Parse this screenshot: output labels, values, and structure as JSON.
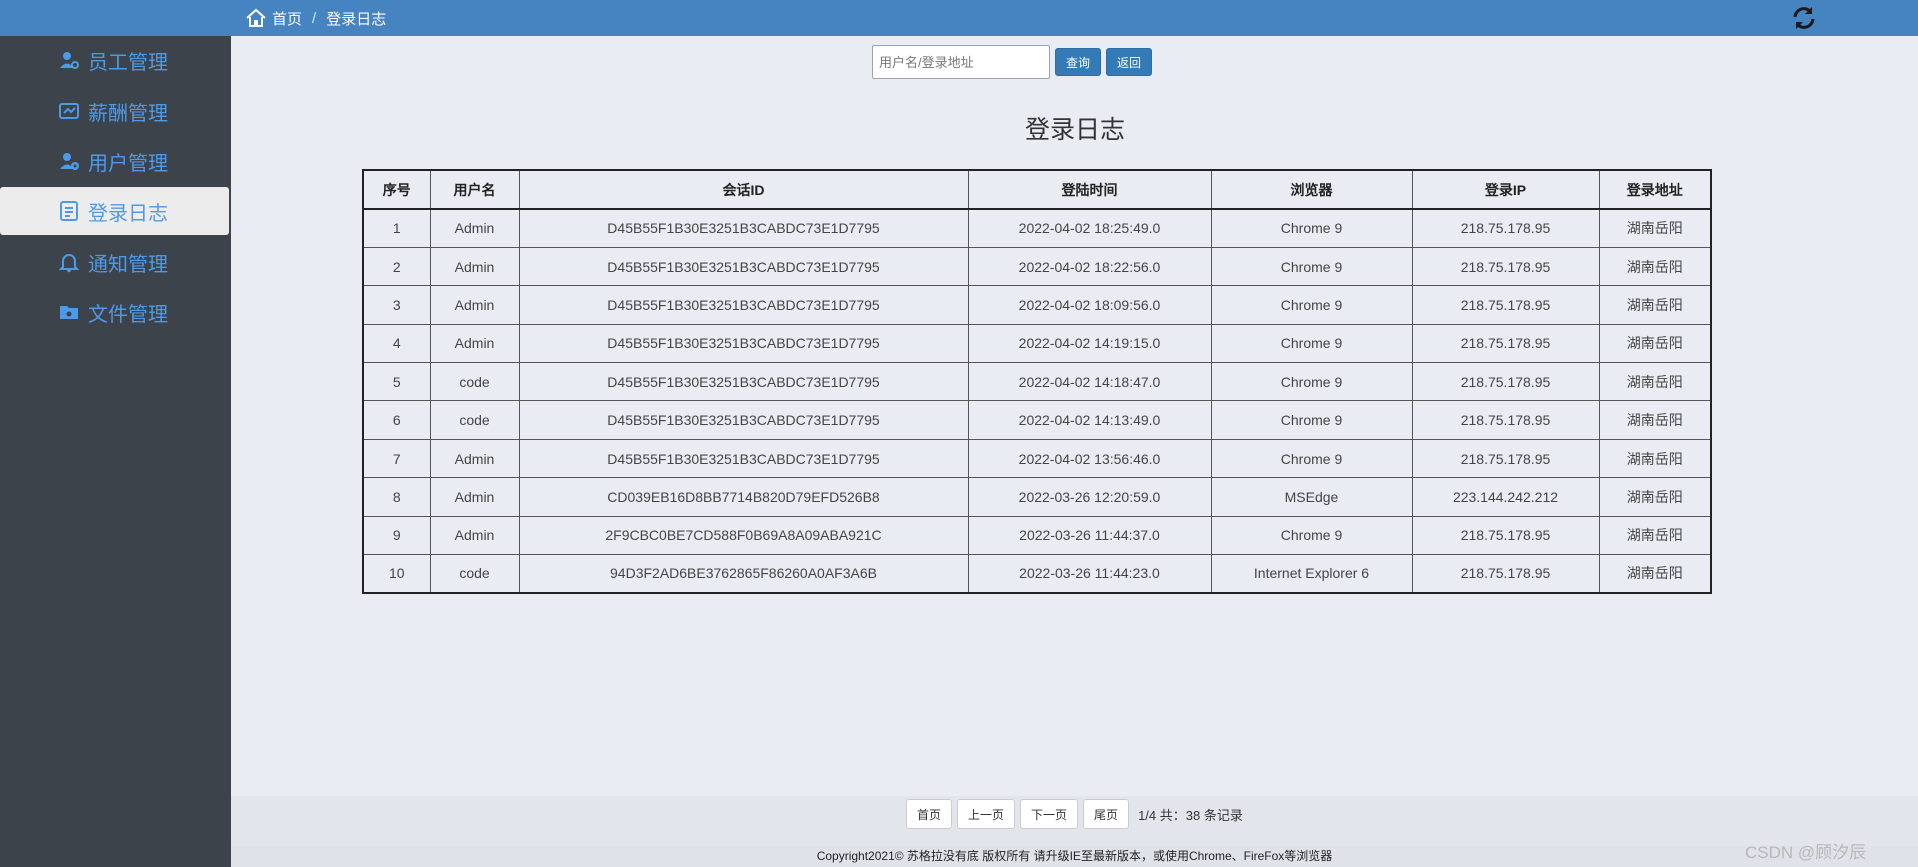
{
  "breadcrumb": {
    "home": "首页",
    "separator": "/",
    "current": "登录日志"
  },
  "sidebar": {
    "items": [
      {
        "label": "员工管理",
        "icon": "employee-icon",
        "active": false
      },
      {
        "label": "薪酬管理",
        "icon": "salary-icon",
        "active": false
      },
      {
        "label": "用户管理",
        "icon": "user-manage-icon",
        "active": false
      },
      {
        "label": "登录日志",
        "icon": "log-icon",
        "active": true
      },
      {
        "label": "通知管理",
        "icon": "bell-icon",
        "active": false
      },
      {
        "label": "文件管理",
        "icon": "folder-icon",
        "active": false
      }
    ]
  },
  "search": {
    "placeholder": "用户名/登录地址",
    "query_label": "查询",
    "back_label": "返回"
  },
  "title": "登录日志",
  "table": {
    "headers": [
      "序号",
      "用户名",
      "会话ID",
      "登陆时间",
      "浏览器",
      "登录IP",
      "登录地址"
    ],
    "rows": [
      [
        "1",
        "Admin",
        "D45B55F1B30E3251B3CABDC73E1D7795",
        "2022-04-02 18:25:49.0",
        "Chrome 9",
        "218.75.178.95",
        "湖南岳阳"
      ],
      [
        "2",
        "Admin",
        "D45B55F1B30E3251B3CABDC73E1D7795",
        "2022-04-02 18:22:56.0",
        "Chrome 9",
        "218.75.178.95",
        "湖南岳阳"
      ],
      [
        "3",
        "Admin",
        "D45B55F1B30E3251B3CABDC73E1D7795",
        "2022-04-02 18:09:56.0",
        "Chrome 9",
        "218.75.178.95",
        "湖南岳阳"
      ],
      [
        "4",
        "Admin",
        "D45B55F1B30E3251B3CABDC73E1D7795",
        "2022-04-02 14:19:15.0",
        "Chrome 9",
        "218.75.178.95",
        "湖南岳阳"
      ],
      [
        "5",
        "code",
        "D45B55F1B30E3251B3CABDC73E1D7795",
        "2022-04-02 14:18:47.0",
        "Chrome 9",
        "218.75.178.95",
        "湖南岳阳"
      ],
      [
        "6",
        "code",
        "D45B55F1B30E3251B3CABDC73E1D7795",
        "2022-04-02 14:13:49.0",
        "Chrome 9",
        "218.75.178.95",
        "湖南岳阳"
      ],
      [
        "7",
        "Admin",
        "D45B55F1B30E3251B3CABDC73E1D7795",
        "2022-04-02 13:56:46.0",
        "Chrome 9",
        "218.75.178.95",
        "湖南岳阳"
      ],
      [
        "8",
        "Admin",
        "CD039EB16D8BB7714B820D79EFD526B8",
        "2022-03-26 12:20:59.0",
        "MSEdge",
        "223.144.242.212",
        "湖南岳阳"
      ],
      [
        "9",
        "Admin",
        "2F9CBC0BE7CD588F0B69A8A09ABA921C",
        "2022-03-26 11:44:37.0",
        "Chrome 9",
        "218.75.178.95",
        "湖南岳阳"
      ],
      [
        "10",
        "code",
        "94D3F2AD6BE3762865F86260A0AF3A6B",
        "2022-03-26 11:44:23.0",
        "Internet Explorer 6",
        "218.75.178.95",
        "湖南岳阳"
      ]
    ]
  },
  "pager": {
    "first": "首页",
    "prev": "上一页",
    "next": "下一页",
    "last": "尾页",
    "info": "1/4 共：38 条记录"
  },
  "footer": "Copyright2021© 苏格拉没有底 版权所有 请升级IE至最新版本，或使用Chrome、FireFox等浏览器",
  "watermark": "CSDN @顾汐辰",
  "colors": {
    "topbar": "#4583c1",
    "sidebar": "#3c434b",
    "accent": "#4d9be8",
    "button": "#337ab7"
  }
}
